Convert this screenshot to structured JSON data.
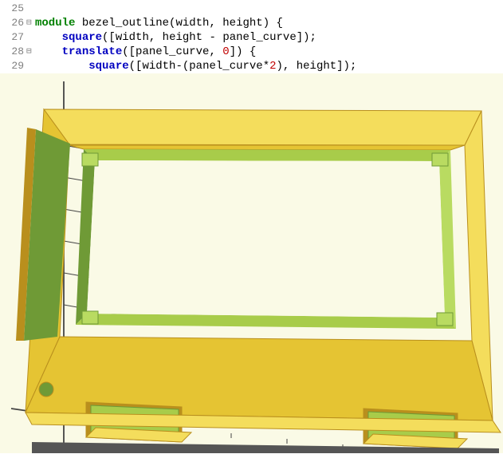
{
  "editor": {
    "lines": [
      {
        "num": "25",
        "fold": "",
        "tokens": []
      },
      {
        "num": "26",
        "fold": "⊟",
        "tokens": [
          {
            "t": "kw",
            "v": "module"
          },
          {
            "t": "sp",
            "v": " "
          },
          {
            "t": "id",
            "v": "bezel_outline"
          },
          {
            "t": "pun",
            "v": "("
          },
          {
            "t": "id",
            "v": "width"
          },
          {
            "t": "pun",
            "v": ", "
          },
          {
            "t": "id",
            "v": "height"
          },
          {
            "t": "pun",
            "v": ") {"
          }
        ]
      },
      {
        "num": "27",
        "fold": "",
        "indent": "    ",
        "tokens": [
          {
            "t": "fn",
            "v": "square"
          },
          {
            "t": "pun",
            "v": "(["
          },
          {
            "t": "id",
            "v": "width"
          },
          {
            "t": "pun",
            "v": ", "
          },
          {
            "t": "id",
            "v": "height"
          },
          {
            "t": "pun",
            "v": " - "
          },
          {
            "t": "id",
            "v": "panel_curve"
          },
          {
            "t": "pun",
            "v": "]);"
          }
        ]
      },
      {
        "num": "28",
        "fold": "⊟",
        "indent": "    ",
        "tokens": [
          {
            "t": "fn",
            "v": "translate"
          },
          {
            "t": "pun",
            "v": "(["
          },
          {
            "t": "id",
            "v": "panel_curve"
          },
          {
            "t": "pun",
            "v": ", "
          },
          {
            "t": "num",
            "v": "0"
          },
          {
            "t": "pun",
            "v": "]) {"
          }
        ]
      },
      {
        "num": "29",
        "fold": "",
        "indent": "        ",
        "tokens": [
          {
            "t": "fn",
            "v": "square"
          },
          {
            "t": "pun",
            "v": "(["
          },
          {
            "t": "id",
            "v": "width"
          },
          {
            "t": "pun",
            "v": "-("
          },
          {
            "t": "id",
            "v": "panel_curve"
          },
          {
            "t": "pun",
            "v": "*"
          },
          {
            "t": "num",
            "v": "2"
          },
          {
            "t": "pun",
            "v": "), "
          },
          {
            "t": "id",
            "v": "height"
          },
          {
            "t": "pun",
            "v": "]);"
          }
        ]
      }
    ]
  },
  "viewport": {
    "bg": "#fafae6",
    "axis_color": "#444",
    "colors": {
      "outer": "#e5c433",
      "outer_light": "#f4dd5c",
      "outer_dark": "#b98f1d",
      "inner": "#a8cc4a",
      "inner_light": "#b9db61",
      "inner_dark": "#6f9a36",
      "shadow": "#555"
    }
  }
}
